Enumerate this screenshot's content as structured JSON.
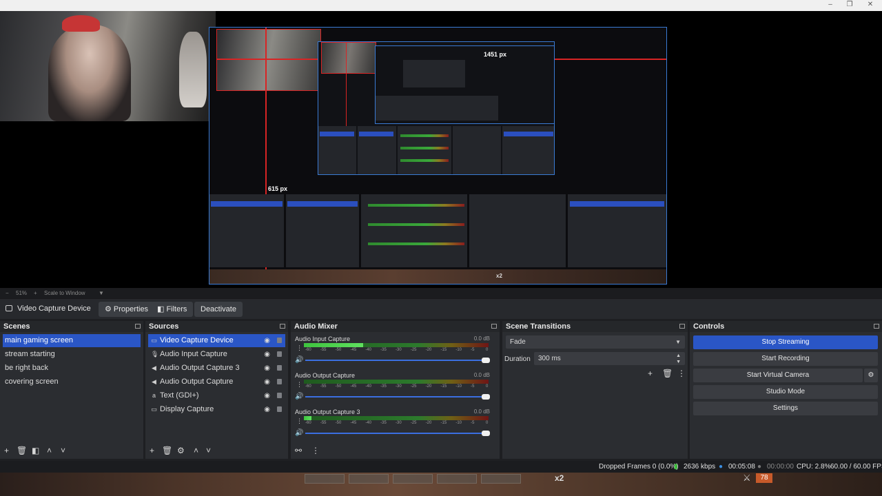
{
  "preview": {
    "px_label_top": "1451 px",
    "px_label_inner": "615 px",
    "zoom_label": "x2",
    "zoom_level": "51%",
    "scale_mode": "Scale to Window"
  },
  "source_toolbar": {
    "source_name": "Video Capture Device",
    "properties_label": "Properties",
    "filters_label": "Filters",
    "deactivate_label": "Deactivate"
  },
  "scenes": {
    "title": "Scenes",
    "items": [
      "main gaming screen",
      "stream starting",
      "be right back",
      "covering screen"
    ],
    "selected_index": 0
  },
  "sources": {
    "title": "Sources",
    "items": [
      {
        "label": "Video Capture Device",
        "icon": "camera-icon"
      },
      {
        "label": "Audio Input Capture",
        "icon": "microphone-icon"
      },
      {
        "label": "Audio Output Capture 3",
        "icon": "speaker-icon"
      },
      {
        "label": "Audio Output Capture",
        "icon": "speaker-icon"
      },
      {
        "label": "Text (GDI+)",
        "icon": "text-icon"
      },
      {
        "label": "Display Capture",
        "icon": "monitor-icon"
      }
    ],
    "selected_index": 0
  },
  "audio_mixer": {
    "title": "Audio Mixer",
    "ticks": [
      "-60",
      "-55",
      "-50",
      "-45",
      "-40",
      "-35",
      "-30",
      "-25",
      "-20",
      "-15",
      "-10",
      "-5",
      "0"
    ],
    "channels": [
      {
        "name": "Audio Input Capture",
        "db": "0.0 dB",
        "level": 0.32
      },
      {
        "name": "Audio Output Capture",
        "db": "0.0 dB",
        "level": 0.0
      },
      {
        "name": "Audio Output Capture 3",
        "db": "0.0 dB",
        "level": 0.04
      }
    ]
  },
  "scene_transitions": {
    "title": "Scene Transitions",
    "transition": "Fade",
    "duration_label": "Duration",
    "duration_value": "300 ms"
  },
  "controls": {
    "title": "Controls",
    "start_streaming_state": "Stop Streaming",
    "start_recording": "Start Recording",
    "start_virtual_camera": "Start Virtual Camera",
    "studio_mode": "Studio Mode",
    "settings": "Settings"
  },
  "status": {
    "dropped_frames": "Dropped Frames 0 (0.0%)",
    "bitrate": "2636 kbps",
    "stream_time": "00:05:08",
    "record_time": "00:00:00",
    "cpu": "CPU: 2.8%",
    "fps": "60.00 / 60.00 FPS"
  },
  "game": {
    "multiplier": "x2",
    "counter": "78"
  },
  "colors": {
    "accent": "#2a56c6",
    "panel": "#2b2d31",
    "preview_border": "#3a7bd5",
    "red_guide": "#d92424"
  }
}
